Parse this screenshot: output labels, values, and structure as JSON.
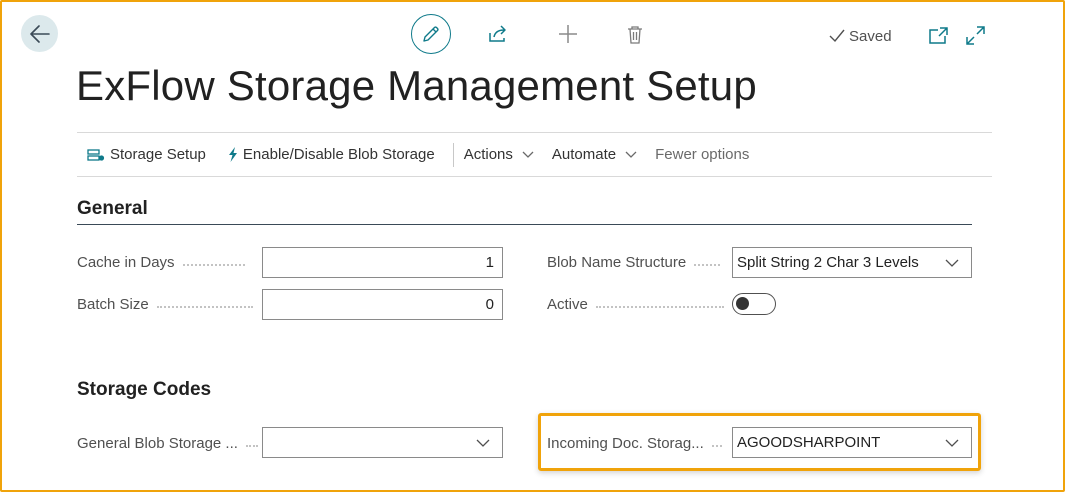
{
  "window": {
    "saved_label": "Saved"
  },
  "page": {
    "title": "ExFlow Storage Management Setup"
  },
  "actions": {
    "storage_setup": "Storage Setup",
    "enable_disable": "Enable/Disable Blob Storage",
    "actions_menu": "Actions",
    "automate_menu": "Automate",
    "fewer_options": "Fewer options"
  },
  "general": {
    "title": "General",
    "cache_label": "Cache in Days",
    "cache_value": "1",
    "batch_label": "Batch Size",
    "batch_value": "0",
    "blob_name_label": "Blob Name Structure",
    "blob_name_value": "Split String 2 Char 3 Levels",
    "active_label": "Active",
    "active_value": false
  },
  "storage_codes": {
    "title": "Storage Codes",
    "general_blob_label": "General Blob Storage ...",
    "general_blob_value": "",
    "incoming_doc_label": "Incoming Doc. Storag...",
    "incoming_doc_value": "AGOODSHARPOINT"
  },
  "colors": {
    "accent": "#0f7a8a",
    "highlight": "#f0a30a"
  },
  "icons": [
    "back-arrow-icon",
    "pencil-icon",
    "share-icon",
    "plus-icon",
    "trash-icon",
    "checkmark-icon",
    "popout-icon",
    "expand-icon",
    "storage-setup-icon",
    "lightning-icon",
    "chevron-down-icon"
  ]
}
